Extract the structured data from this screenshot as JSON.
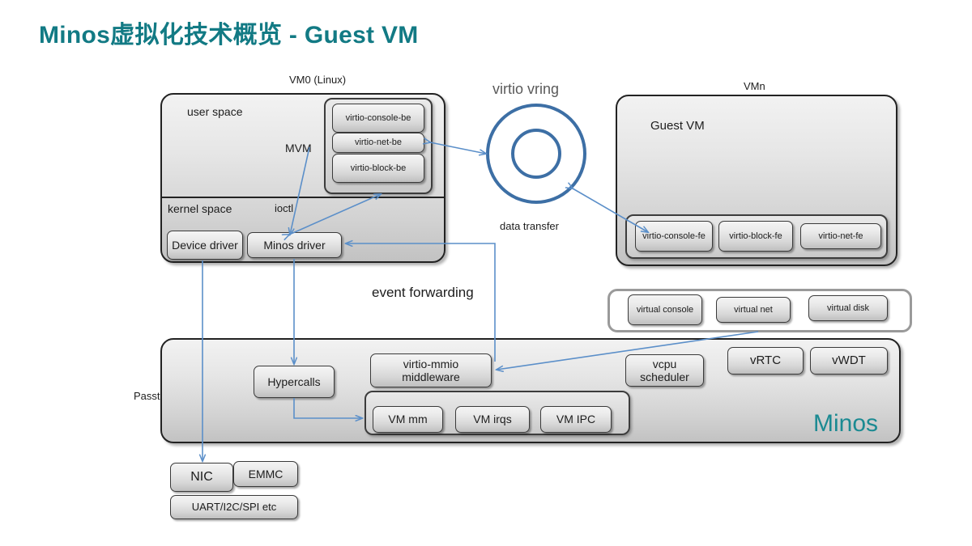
{
  "title": "Minos虚拟化技术概览 - Guest VM",
  "accent_color": "#127a84",
  "arrow_color": "#5b8fc9",
  "vring_color": "#3d6fa5",
  "labels": {
    "vm0_caption": "VM0 (Linux)",
    "vmn_caption": "VMn",
    "user_space": "user space",
    "kernel_space": "kernel space",
    "mvm": "MVM",
    "ioctl": "ioctl",
    "virtio_vring": "virtio vring",
    "data_transfer": "data transfer",
    "event_forwarding": "event forwarding",
    "passthough": "Passthough",
    "guest_vm": "Guest VM",
    "minos": "Minos"
  },
  "vm0": {
    "backends": [
      {
        "label": "virtio-console-be"
      },
      {
        "label": "virtio-net-be"
      },
      {
        "label": "virtio-block-be"
      }
    ],
    "kernel_boxes": [
      {
        "label": "Device driver"
      },
      {
        "label": "Minos driver"
      }
    ]
  },
  "vmn": {
    "frontends": [
      {
        "label": "virtio-console-fe"
      },
      {
        "label": "virtio-block-fe"
      },
      {
        "label": "virtio-net-fe"
      }
    ]
  },
  "virtual_devices": [
    {
      "label": "virtual console"
    },
    {
      "label": "virtual net"
    },
    {
      "label": "virtual disk"
    }
  ],
  "minos_blocks": [
    {
      "label": "Hypercalls"
    },
    {
      "label": "virtio-mmio middleware"
    },
    {
      "label": "vcpu scheduler"
    },
    {
      "label": "vRTC"
    },
    {
      "label": "vWDT"
    }
  ],
  "vm_group": [
    {
      "label": "VM mm"
    },
    {
      "label": "VM irqs"
    },
    {
      "label": "VM IPC"
    }
  ],
  "hardware": [
    {
      "label": "NIC"
    },
    {
      "label": "EMMC"
    },
    {
      "label": "UART/I2C/SPI etc"
    }
  ]
}
